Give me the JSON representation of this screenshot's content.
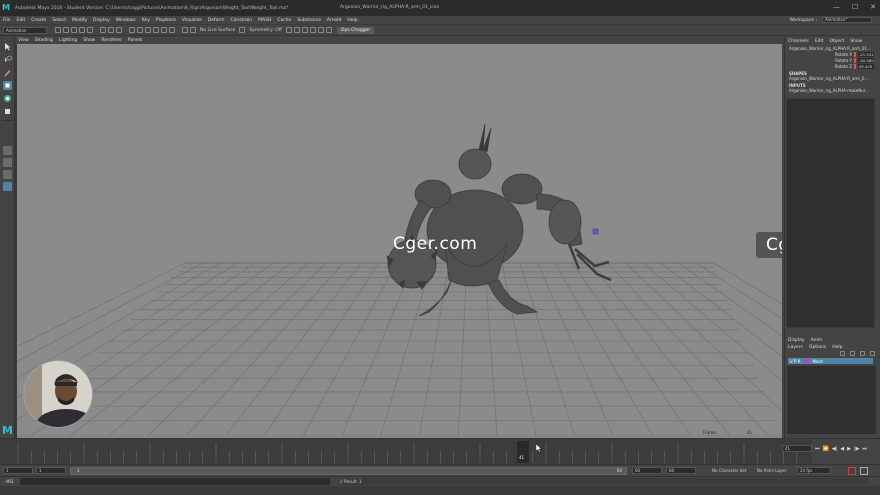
{
  "title_bar": {
    "app_title": "Autodesk Maya 2016 - Student Version: C:\\Users\\chagg\\Pictures\\Animation\\8_Rigs\\Argonian\\Weight_Tool\\Weight_Tool.ma*",
    "center_title": "Argonian_Warrior_rig_ALPHA:R_arm_01_icon",
    "minimize": "—",
    "maximize": "☐",
    "close": "✕"
  },
  "menu": {
    "items": [
      "File",
      "Edit",
      "Create",
      "Select",
      "Modify",
      "Display",
      "Windows",
      "Key",
      "Playback",
      "Visualize",
      "Deform",
      "Constrain",
      "MASH",
      "Cache",
      "Substance",
      "Arnold",
      "Help"
    ],
    "workspace_label": "Workspace :",
    "workspace_value": "Animation*"
  },
  "status_line": {
    "mode": "Animation",
    "no_live_surface": "No Live Surface",
    "symmetry": "Symmetry: Off",
    "quick_button": "Ops Chagger"
  },
  "viewport": {
    "menu": [
      "View",
      "Shading",
      "Lighting",
      "Show",
      "Renderer",
      "Panels"
    ],
    "frame_label": "Frame:",
    "frame_value": "41"
  },
  "watermarks": [
    "Cger.com",
    "Cger.com"
  ],
  "channel_box": {
    "tabs": [
      "Channels",
      "Edit",
      "Object",
      "Show"
    ],
    "object_name": "Argonian_Warrior_rig_ALPHA:R_arm_01...",
    "attributes": [
      {
        "label": "Rotate X",
        "value": "-21.541"
      },
      {
        "label": "Rotate Y",
        "value": "-40.580"
      },
      {
        "label": "Rotate Z",
        "value": "45.425"
      }
    ],
    "shapes_header": "SHAPES",
    "shapes_item": "Argonian_Warrior_rig_ALPHA:R_arm_0...",
    "inputs_header": "INPUTS",
    "inputs_item": "Argonian_Warrior_rig_ALPHA:makeNur..."
  },
  "layer_editor": {
    "tabs": [
      "Display",
      "Anim"
    ],
    "subtabs": [
      "Layers",
      "Options",
      "Help"
    ],
    "layer_flags": "V  P  R",
    "layer_name": "Mesh"
  },
  "time_slider": {
    "current_frame": "41",
    "frame_field": "41"
  },
  "range_slider": {
    "start_field": "1",
    "start_inner": "1",
    "range_start_marker": "1",
    "range_end_marker": "60",
    "end_inner": "60",
    "end_field": "60",
    "character_set": "No Character Set",
    "anim_layer": "No Anim Layer",
    "fps": "24 fps"
  },
  "command_line": {
    "lang": "MEL",
    "result": "// Result: 1"
  },
  "colors": {
    "viewport_bg": "#8b8b8b",
    "active_tool": "#5285a5",
    "layer_color": "#c040c8",
    "maya_logo": "#35c0c8"
  }
}
